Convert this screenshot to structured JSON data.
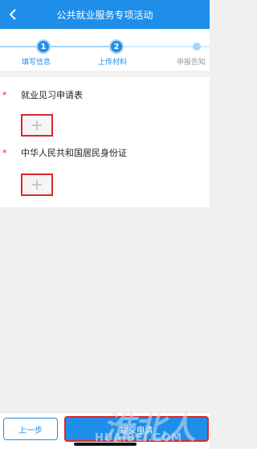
{
  "header": {
    "title": "公共就业服务专项活动",
    "back_icon": "chevron-left-icon"
  },
  "steps": [
    {
      "number": "1",
      "label": "填写信息",
      "state": "done"
    },
    {
      "number": "2",
      "label": "上传材料",
      "state": "current"
    },
    {
      "number": "",
      "label": "申报告知",
      "state": "pending"
    }
  ],
  "form": {
    "items": [
      {
        "required_mark": "*",
        "label": "就业见习申请表",
        "upload_icon": "plus-icon"
      },
      {
        "required_mark": "*",
        "label": "中华人民共和国居民身份证",
        "upload_icon": "plus-icon"
      }
    ]
  },
  "footer": {
    "prev_label": "上一步",
    "submit_label": "提交申请"
  },
  "watermark": {
    "mark": "淮北人",
    "text": "HUAIBEI.COM"
  },
  "colors": {
    "primary": "#1e8ee8",
    "highlight": "#d9282e",
    "required": "#e02020"
  }
}
